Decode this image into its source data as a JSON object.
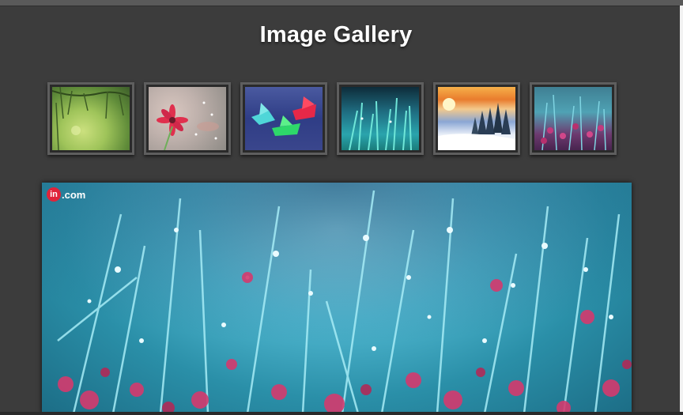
{
  "page": {
    "title": "Image Gallery"
  },
  "thumbnails": [
    {
      "subject": "green leaves"
    },
    {
      "subject": "pink flower with raindrops"
    },
    {
      "subject": "paper boats"
    },
    {
      "subject": "grass with dew"
    },
    {
      "subject": "snowy sunset forest"
    },
    {
      "subject": "blue and purple plants"
    }
  ],
  "main_image": {
    "subject": "dewy grass with pink flowers",
    "watermark": {
      "badge": "in",
      "text": ".com"
    }
  },
  "colors": {
    "background": "#3c3c3c",
    "title": "#ffffff",
    "thumb_border": "#5e5e5e",
    "accent_pink": "#d43a6e",
    "accent_teal": "#4fb6cf"
  }
}
